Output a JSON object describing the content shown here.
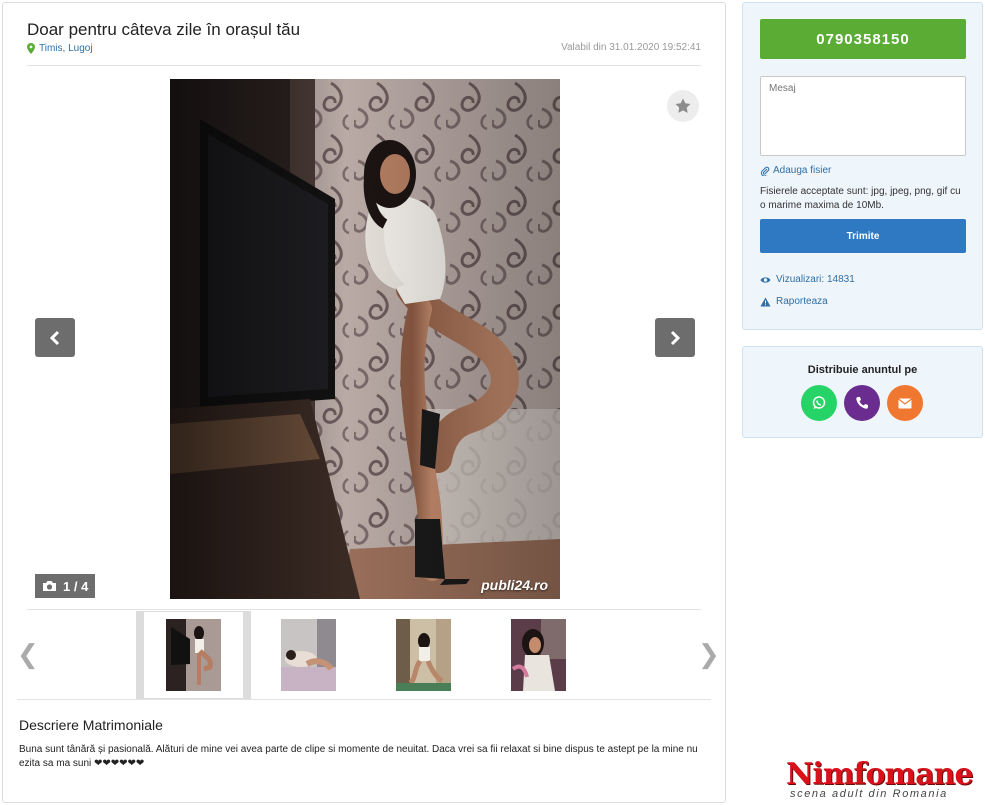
{
  "listing": {
    "title": "Doar pentru câteva zile în orașul tău",
    "location": "Timis, Lugoj",
    "valid_from": "Valabil din 31.01.2020 19:52:41"
  },
  "gallery": {
    "counter": "1 / 4",
    "watermark": "publi24.ro",
    "current_index": 1,
    "total": 4,
    "prev_arrow": "‹",
    "next_arrow": "›",
    "thumb_prev": "❮",
    "thumb_next": "❯"
  },
  "description": {
    "heading": "Descriere Matrimoniale",
    "text": "Buna sunt tânără și pasională. Alături de mine vei avea parte de clipe si momente de neuitat. Daca vrei sa fii relaxat si bine dispus te astept pe la mine nu ezita sa ma suni ❤❤❤❤❤❤"
  },
  "contact": {
    "phone": "0790358150",
    "message_placeholder": "Mesaj",
    "attach_label": "Adauga fisier",
    "accepted_files": "Fisierele acceptate sunt: jpg, jpeg, png, gif cu o marime maxima de 10Mb.",
    "send_label": "Trimite",
    "views": "Vizualizari: 14831",
    "report_label": "Raporteaza"
  },
  "share": {
    "title": "Distribuie anuntul pe",
    "colors": {
      "whatsapp": "#25d366",
      "viber": "#6a2c8f",
      "email": "#f0772f"
    }
  },
  "logo": {
    "name": "Nimfomane",
    "tagline": "scena adult din Romania"
  },
  "colors": {
    "phone_button": "#5aac34",
    "send_button": "#2e79c2",
    "link": "#2d6fa8",
    "panel_bg": "#eef5fb",
    "logo_red": "#d8111b"
  }
}
